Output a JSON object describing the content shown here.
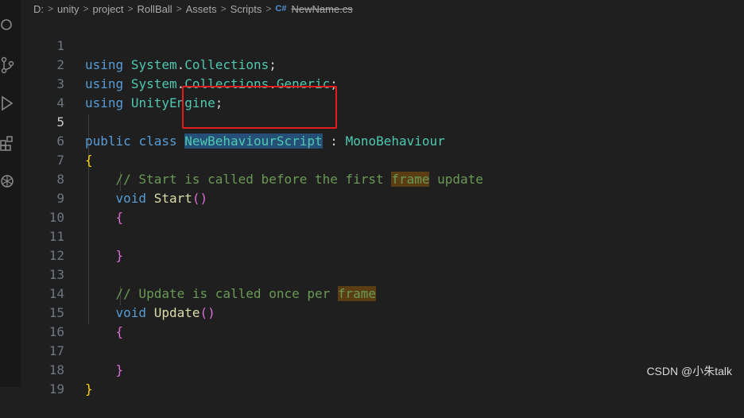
{
  "breadcrumb": {
    "drive": "D:",
    "folders": [
      "unity",
      "project",
      "RollBall",
      "Assets",
      "Scripts"
    ],
    "file_icon": "C#",
    "file": "NewName.cs"
  },
  "activity_icons": [
    "search-icon",
    "source-control-icon",
    "run-debug-icon",
    "extensions-icon",
    "openai-icon"
  ],
  "line_numbers": [
    "1",
    "2",
    "3",
    "4",
    "5",
    "6",
    "7",
    "8",
    "9",
    "10",
    "11",
    "12",
    "13",
    "14",
    "15",
    "16",
    "17",
    "18",
    "19"
  ],
  "code": {
    "l1": {
      "kw": "using",
      "ns1": "System",
      "dot": ".",
      "ns2": "Collections",
      "semi": ";"
    },
    "l2": {
      "kw": "using",
      "ns1": "System",
      "dot1": ".",
      "ns2": "Collections",
      "dot2": ".",
      "ns3": "Generic",
      "semi": ";"
    },
    "l3": {
      "kw": "using",
      "ns1": "UnityEngine",
      "semi": ";"
    },
    "l5": {
      "kw1": "public",
      "kw2": "class",
      "classname": "NewBehaviourScript",
      "colon": ":",
      "base": "MonoBehaviour"
    },
    "l6": {
      "brace": "{"
    },
    "l7": {
      "comment": "// Start is called before the first ",
      "hl": "frame",
      "rest": " update"
    },
    "l8": {
      "kw": "void",
      "fn": "Start",
      "parens": "()"
    },
    "l9": {
      "brace": "{"
    },
    "l11": {
      "brace": "}"
    },
    "l13": {
      "comment": "// Update is called once per ",
      "hl": "frame"
    },
    "l14": {
      "kw": "void",
      "fn": "Update",
      "parens": "()"
    },
    "l15": {
      "brace": "{"
    },
    "l17": {
      "brace": "}"
    },
    "l18": {
      "brace": "}"
    }
  },
  "watermark": "CSDN @小朱talk",
  "colors": {
    "background": "#1f1f1f",
    "keyword": "#569cd6",
    "type": "#4ec9b0",
    "function": "#dcdcaa",
    "comment": "#6a9955",
    "selection": "#264f78",
    "annotation_box": "#e51c1c"
  }
}
